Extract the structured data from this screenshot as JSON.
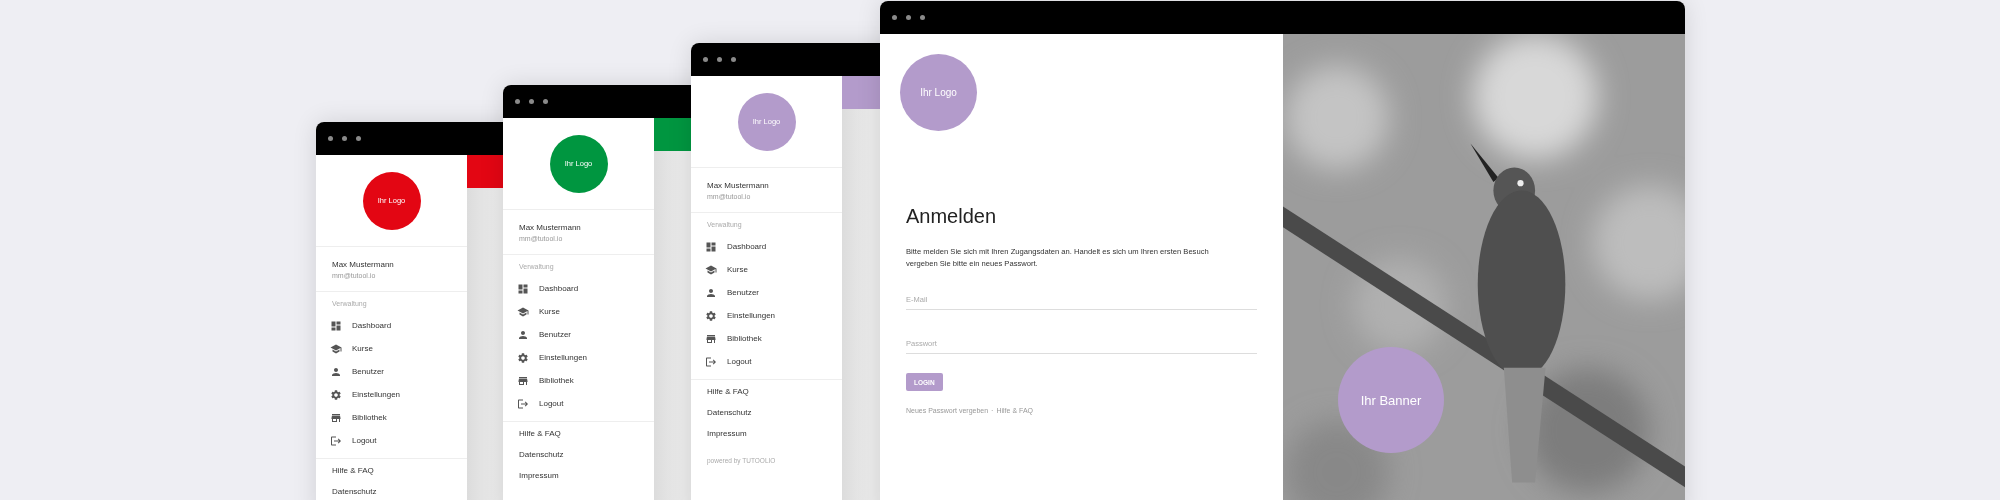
{
  "windows": [
    {
      "kind": "admin",
      "color": "#e30613",
      "logo": "Ihr Logo",
      "user": {
        "name": "Max Mustermann",
        "email": "mm@tutool.io"
      },
      "section": "Verwaltung",
      "menu": [
        "Dashboard",
        "Kurse",
        "Benutzer",
        "Einstellungen",
        "Bibliothek",
        "Logout"
      ],
      "links": [
        "Hilfe & FAQ",
        "Datenschutz"
      ]
    },
    {
      "kind": "admin",
      "color": "#009640",
      "logo": "Ihr Logo",
      "user": {
        "name": "Max Mustermann",
        "email": "mm@tutool.io"
      },
      "section": "Verwaltung",
      "menu": [
        "Dashboard",
        "Kurse",
        "Benutzer",
        "Einstellungen",
        "Bibliothek",
        "Logout"
      ],
      "links": [
        "Hilfe & FAQ",
        "Datenschutz",
        "Impressum"
      ]
    },
    {
      "kind": "admin",
      "color": "#b39bcb",
      "logo": "Ihr Logo",
      "user": {
        "name": "Max Mustermann",
        "email": "mm@tutool.io"
      },
      "section": "Verwaltung",
      "menu": [
        "Dashboard",
        "Kurse",
        "Benutzer",
        "Einstellungen",
        "Bibliothek",
        "Logout"
      ],
      "links": [
        "Hilfe & FAQ",
        "Datenschutz",
        "Impressum"
      ],
      "powered_by": "powered by TUTOOLIO"
    },
    {
      "kind": "login",
      "color": "#b39bcb",
      "logo": "Ihr Logo",
      "title": "Anmelden",
      "intro": "Bitte melden Sie sich mit Ihren Zugangsdaten an. Handelt es sich um Ihren ersten Besuch vergeben Sie bitte ein neues Passwort.",
      "fields": [
        {
          "placeholder": "E-Mail"
        },
        {
          "placeholder": "Passwort"
        }
      ],
      "button": "LOGIN",
      "footer_links": [
        "Neues Passwort vergeben",
        "Hilfe & FAQ"
      ],
      "separator": "·",
      "banner": "Ihr Banner"
    }
  ]
}
